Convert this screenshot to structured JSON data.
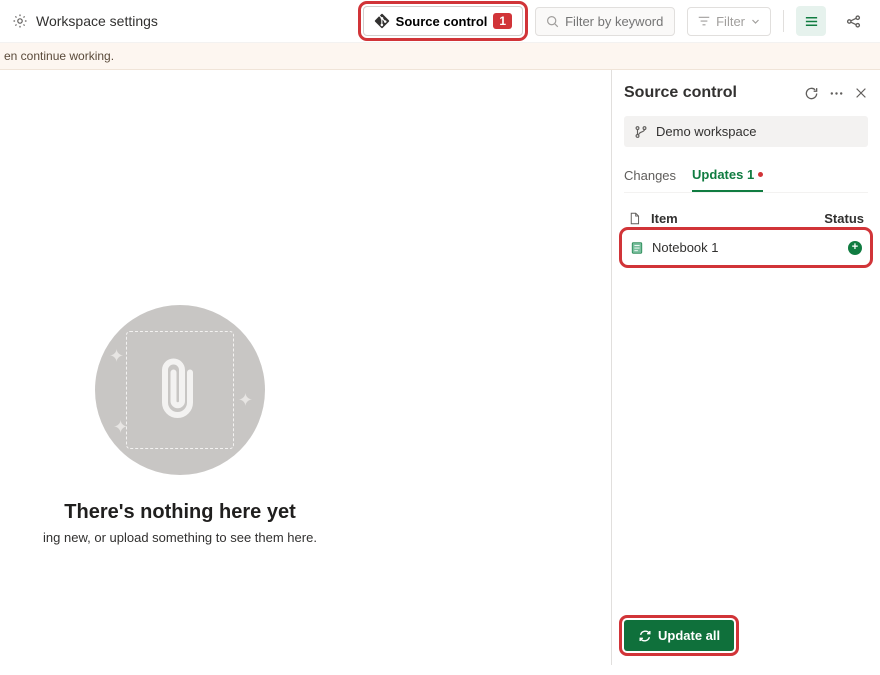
{
  "topbar": {
    "workspace_settings_label": "Workspace settings",
    "source_control_label": "Source control",
    "source_control_badge": "1",
    "search_placeholder": "Filter by keyword",
    "filter_label": "Filter"
  },
  "warning": {
    "text": "en continue working."
  },
  "empty_state": {
    "title": "There's nothing here yet",
    "subtitle": "ing new, or upload something to see them here."
  },
  "panel": {
    "title": "Source control",
    "workspace_name": "Demo workspace",
    "tabs": {
      "changes": "Changes",
      "updates": "Updates 1"
    },
    "columns": {
      "item": "Item",
      "status": "Status"
    },
    "items": [
      {
        "name": "Notebook 1",
        "status": "added"
      }
    ],
    "update_all_label": "Update all"
  }
}
